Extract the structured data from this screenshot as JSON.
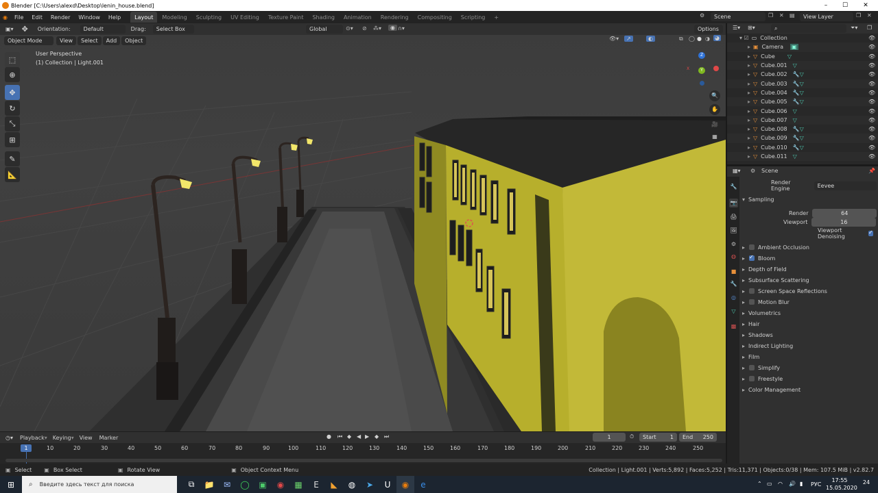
{
  "window": {
    "title": "Blender [C:\\Users\\alexd\\Desktop\\lenin_house.blend]",
    "minimize": "–",
    "maximize": "☐",
    "close": "✕"
  },
  "topbar": {
    "menus": [
      "File",
      "Edit",
      "Render",
      "Window",
      "Help"
    ],
    "workspaces": [
      "Layout",
      "Modeling",
      "Sculpting",
      "UV Editing",
      "Texture Paint",
      "Shading",
      "Animation",
      "Rendering",
      "Compositing",
      "Scripting"
    ],
    "active_workspace": "Layout",
    "add_tab": "+",
    "scene_name": "Scene",
    "view_layer": "View Layer"
  },
  "viewport_header": {
    "orientation_label": "Orientation:",
    "orientation_value": "Default",
    "drag_label": "Drag:",
    "drag_value": "Select Box",
    "transform_space": "Global",
    "options": "Options",
    "mode": "Object Mode",
    "menus": [
      "View",
      "Select",
      "Add",
      "Object"
    ]
  },
  "viewport": {
    "view_name": "User Perspective",
    "context": "(1) Collection | Light.001",
    "gizmo": {
      "z": "Z",
      "y": "Y",
      "x": "X"
    }
  },
  "outliner": {
    "search_placeholder": "",
    "items": [
      {
        "name": "Collection",
        "kind": "collection"
      },
      {
        "name": "Camera",
        "kind": "camera"
      },
      {
        "name": "Cube",
        "kind": "mesh"
      },
      {
        "name": "Cube.001",
        "kind": "mesh"
      },
      {
        "name": "Cube.002",
        "kind": "mesh"
      },
      {
        "name": "Cube.003",
        "kind": "mesh"
      },
      {
        "name": "Cube.004",
        "kind": "mesh"
      },
      {
        "name": "Cube.005",
        "kind": "mesh"
      },
      {
        "name": "Cube.006",
        "kind": "mesh"
      },
      {
        "name": "Cube.007",
        "kind": "mesh"
      },
      {
        "name": "Cube.008",
        "kind": "mesh"
      },
      {
        "name": "Cube.009",
        "kind": "mesh"
      },
      {
        "name": "Cube.010",
        "kind": "mesh"
      },
      {
        "name": "Cube.011",
        "kind": "mesh"
      }
    ]
  },
  "properties": {
    "header": "Scene",
    "render_engine_label": "Render Engine",
    "render_engine": "Eevee",
    "sampling": {
      "title": "Sampling",
      "render_label": "Render",
      "render_value": "64",
      "viewport_label": "Viewport",
      "viewport_value": "16",
      "denoise_label": "Viewport Denoising"
    },
    "panels": [
      {
        "label": "Ambient Occlusion",
        "checkbox": true,
        "checked": false
      },
      {
        "label": "Bloom",
        "checkbox": true,
        "checked": true
      },
      {
        "label": "Depth of Field",
        "checkbox": false,
        "checked": false
      },
      {
        "label": "Subsurface Scattering",
        "checkbox": false,
        "checked": false
      },
      {
        "label": "Screen Space Reflections",
        "checkbox": true,
        "checked": false
      },
      {
        "label": "Motion Blur",
        "checkbox": true,
        "checked": false
      },
      {
        "label": "Volumetrics",
        "checkbox": false,
        "checked": false
      },
      {
        "label": "Hair",
        "checkbox": false,
        "checked": false
      },
      {
        "label": "Shadows",
        "checkbox": false,
        "checked": false
      },
      {
        "label": "Indirect Lighting",
        "checkbox": false,
        "checked": false
      },
      {
        "label": "Film",
        "checkbox": false,
        "checked": false
      },
      {
        "label": "Simplify",
        "checkbox": true,
        "checked": false
      },
      {
        "label": "Freestyle",
        "checkbox": true,
        "checked": false
      },
      {
        "label": "Color Management",
        "checkbox": false,
        "checked": false
      }
    ]
  },
  "timeline": {
    "menus": [
      "Playback",
      "Keying",
      "View",
      "Marker"
    ],
    "current_frame": "1",
    "start_label": "Start",
    "start": "1",
    "end_label": "End",
    "end": "250",
    "ticks": [
      "1",
      "10",
      "20",
      "30",
      "40",
      "50",
      "60",
      "70",
      "80",
      "90",
      "100",
      "110",
      "120",
      "130",
      "140",
      "150",
      "160",
      "170",
      "180",
      "190",
      "200",
      "210",
      "220",
      "230",
      "240",
      "250"
    ]
  },
  "statusbar": {
    "select": "Select",
    "box_select": "Box Select",
    "rotate_view": "Rotate View",
    "context_menu": "Object Context Menu",
    "stats": "Collection | Light.001 | Verts:5,892 | Faces:5,252 | Tris:11,371 | Objects:0/38 | Mem: 107.5 MiB | v2.82.7"
  },
  "taskbar": {
    "search_placeholder": "Введите здесь текст для поиска",
    "language": "РУС",
    "time": "17:55",
    "date": "15.05.2020",
    "notifications": "24"
  },
  "colors": {
    "accent": "#4772b3",
    "building_yellow": "#b5ad2a",
    "lamp_glow": "#f2e66a"
  }
}
